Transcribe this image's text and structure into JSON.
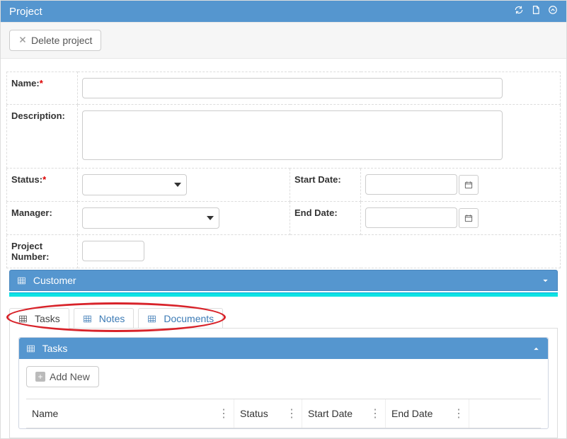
{
  "header": {
    "title": "Project"
  },
  "toolbar": {
    "delete_label": "Delete project"
  },
  "form": {
    "name": {
      "label": "Name:",
      "value": ""
    },
    "description": {
      "label": "Description:",
      "value": ""
    },
    "status": {
      "label": "Status:",
      "value": ""
    },
    "manager": {
      "label": "Manager:",
      "value": ""
    },
    "start_date": {
      "label": "Start Date:",
      "value": ""
    },
    "end_date": {
      "label": "End Date:",
      "value": ""
    },
    "project_number": {
      "label": "Project Number:",
      "value": ""
    }
  },
  "customer_section": {
    "title": "Customer"
  },
  "tabs": [
    {
      "label": "Tasks",
      "active": true
    },
    {
      "label": "Notes",
      "active": false
    },
    {
      "label": "Documents",
      "active": false
    }
  ],
  "tasks_panel": {
    "title": "Tasks",
    "add_new_label": "Add New",
    "columns": [
      "Name",
      "Status",
      "Start Date",
      "End Date"
    ]
  }
}
